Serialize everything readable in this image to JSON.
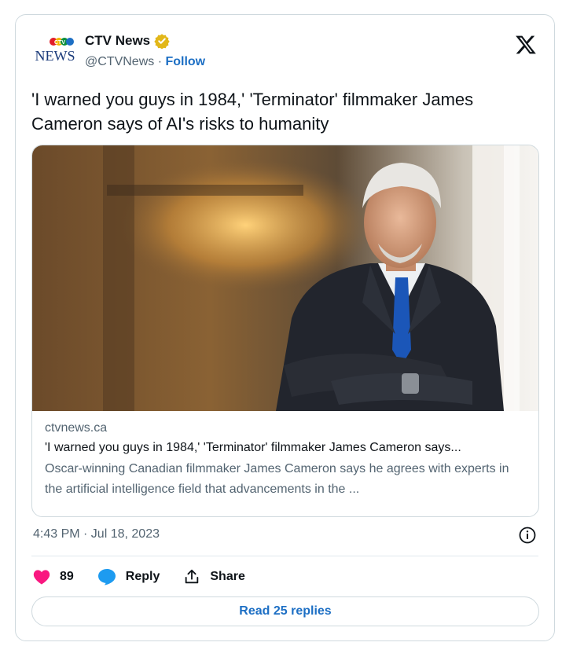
{
  "author": {
    "name": "CTV News",
    "handle": "@CTVNews",
    "separator": " · ",
    "follow_label": "Follow",
    "logo_text_top": "CTV",
    "logo_text_bottom": "NEWS"
  },
  "tweet": {
    "text": "'I warned you guys in 1984,' 'Terminator' filmmaker James Cameron says of AI's risks to humanity",
    "timestamp": "4:43 PM · Jul 18, 2023"
  },
  "link_card": {
    "domain": "ctvnews.ca",
    "title": "'I warned you guys in 1984,' 'Terminator' filmmaker James Cameron says...",
    "description": "Oscar-winning Canadian filmmaker James Cameron says he agrees with experts in the artificial intelligence field that advancements in the ..."
  },
  "actions": {
    "like_count": "89",
    "reply_label": "Reply",
    "share_label": "Share"
  },
  "read_replies_label": "Read 25 replies",
  "colors": {
    "accent": "#1d6fc4",
    "like": "#f91880",
    "verified_badge": "#e2b719",
    "reply_icon": "#1d9bf0"
  },
  "icons": [
    "verified-badge-icon",
    "x-logo-icon",
    "info-icon",
    "heart-icon",
    "reply-icon",
    "share-icon"
  ]
}
